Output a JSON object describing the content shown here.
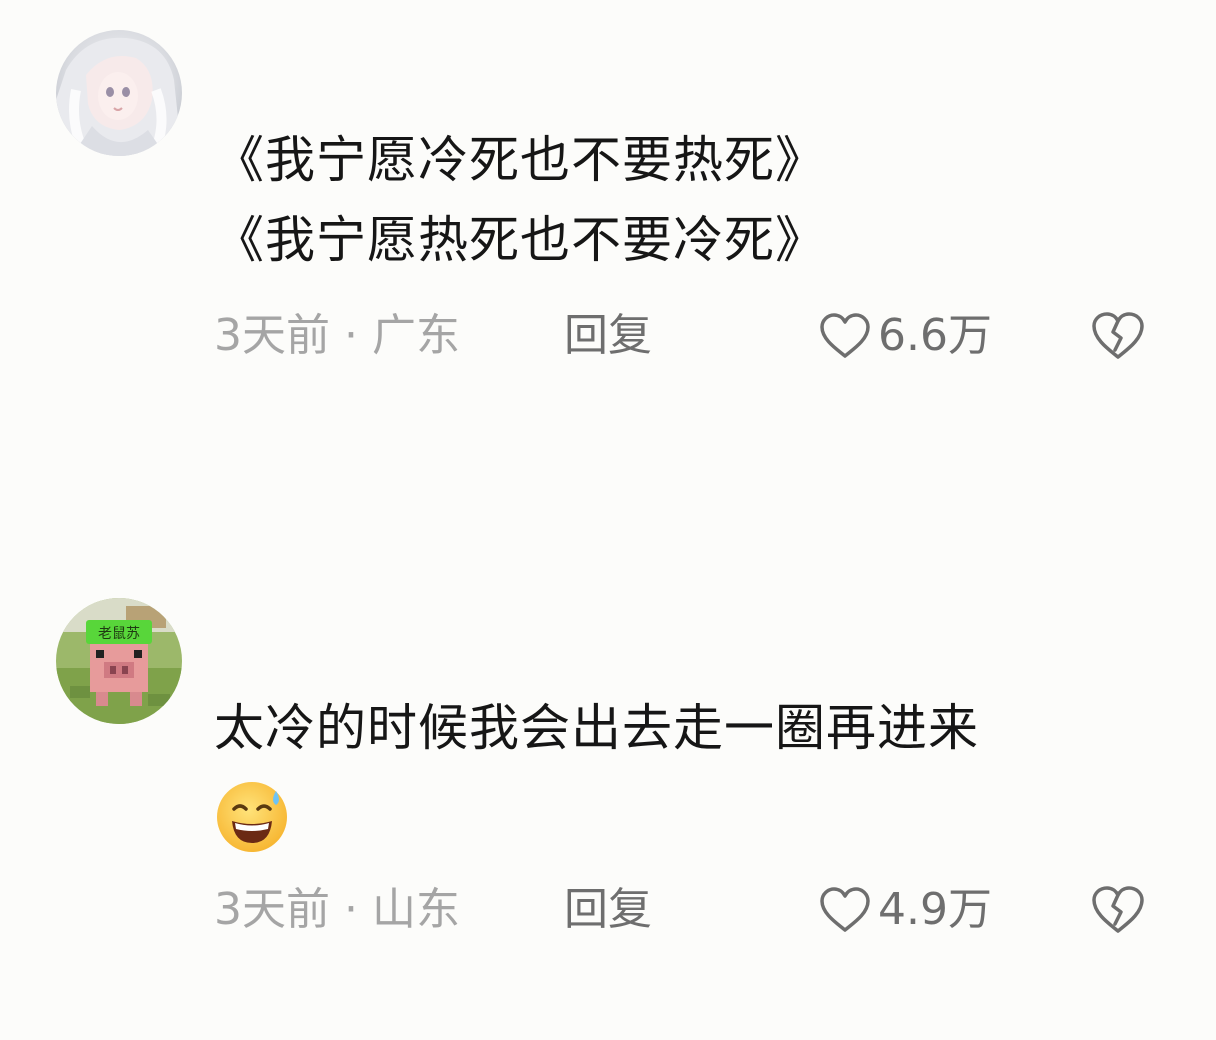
{
  "comments": [
    {
      "avatar_icon": "anime-girl-avatar",
      "lines": [
        "《我宁愿冷死也不要热死》",
        "《我宁愿热死也不要冷死》"
      ],
      "time": "3天前",
      "separator": "·",
      "location": "广东",
      "reply_label": "回复",
      "like_count": "6.6万",
      "emoji_icon": ""
    },
    {
      "avatar_icon": "minecraft-pig-avatar",
      "avatar_tag": "老鼠苏",
      "lines": [
        "太冷的时候我会出去走一圈再进来"
      ],
      "time": "3天前",
      "separator": "·",
      "location": "山东",
      "reply_label": "回复",
      "like_count": "4.9万",
      "emoji_icon": "grinning-sweat-emoji"
    }
  ],
  "colors": {
    "background": "#fcfcfa",
    "text": "#161616",
    "meta": "#a5a5a5",
    "action": "#6e6e6e"
  }
}
